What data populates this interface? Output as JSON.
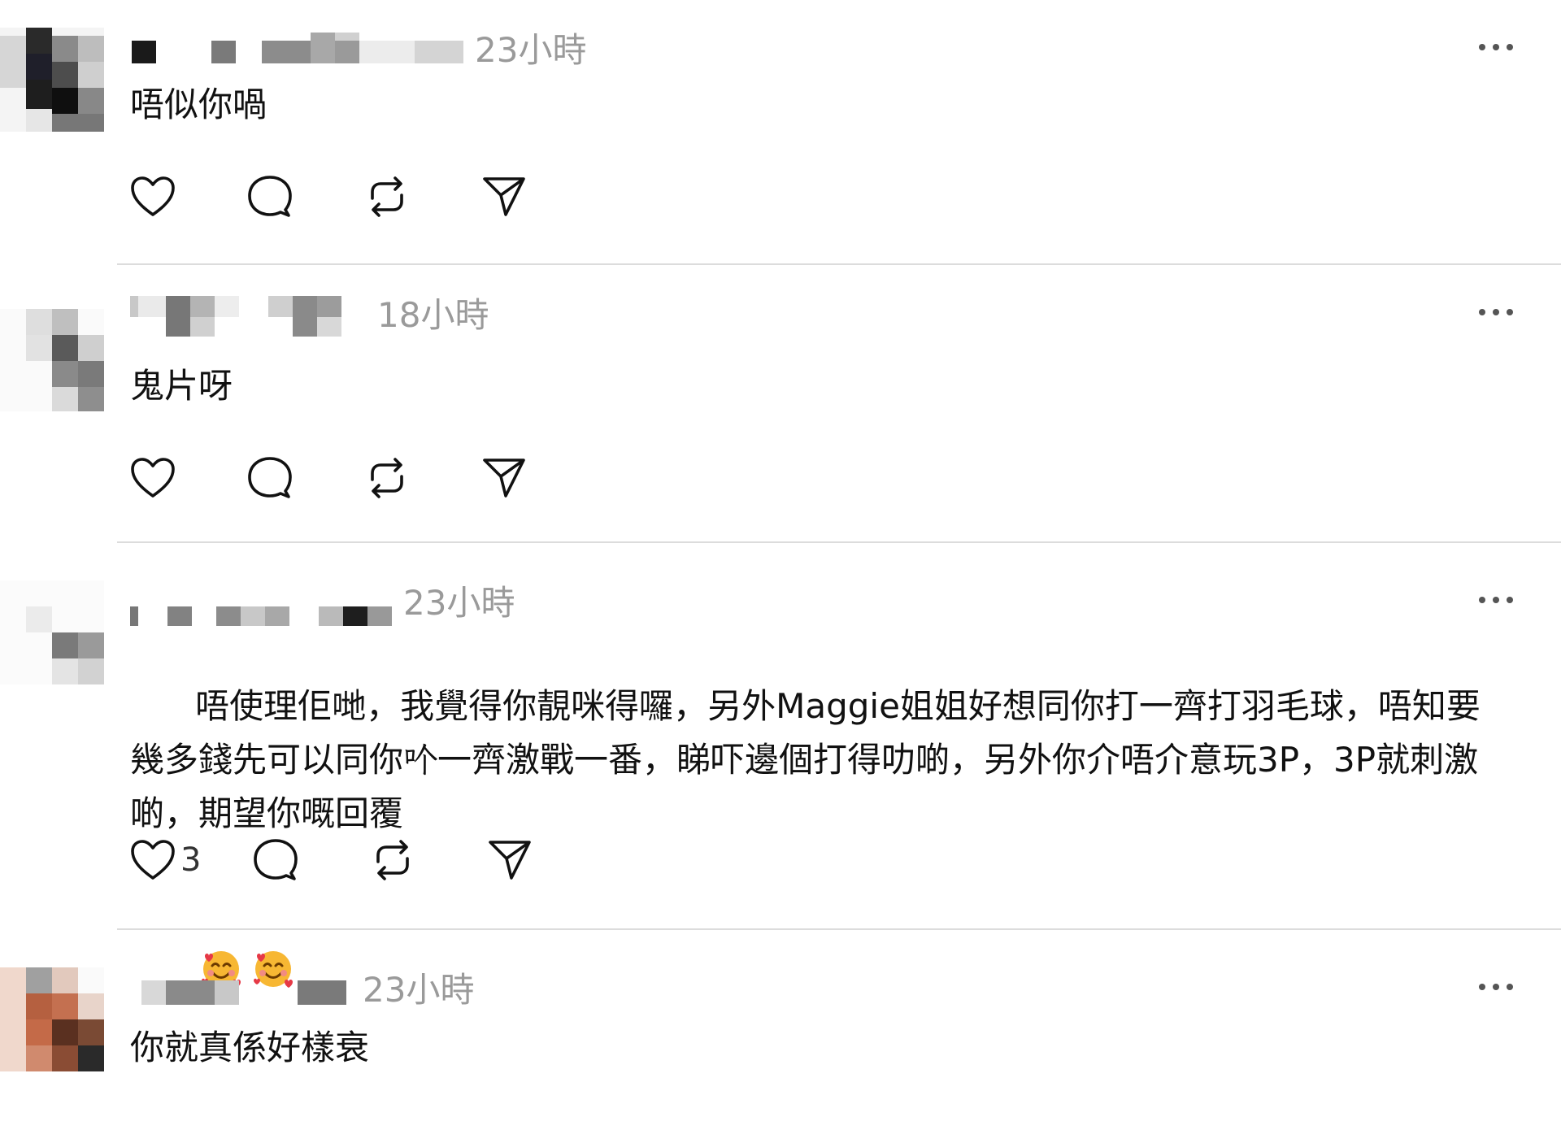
{
  "comments": [
    {
      "timestamp": "23小時",
      "body": "唔似你喎",
      "likes": ""
    },
    {
      "timestamp": "18小時",
      "body": "鬼片呀",
      "likes": ""
    },
    {
      "timestamp": "23小時",
      "body": "唔使理佢哋，我覺得你靚咪得囉，另外Maggie姐姐好想同你打一齊打羽毛球，唔知要幾多錢先可以同你𠮶一齊激戰一番，睇吓邊個打得叻啲，另外你介唔介意玩3P，3P就刺激啲，期望你嘅回覆",
      "likes": "3"
    },
    {
      "timestamp": "23小時",
      "body": "你就真係好樣衰",
      "likes": ""
    }
  ],
  "icons": {
    "like": "heart-icon",
    "reply": "comment-bubble-icon",
    "repost": "repost-icon",
    "share": "send-icon",
    "more": "more-options-icon",
    "emoji": "smiling-face-with-hearts-emoji"
  },
  "colors": {
    "timestamp": "#9a9a9a",
    "divider": "#dcdcdc",
    "text": "#111111"
  }
}
